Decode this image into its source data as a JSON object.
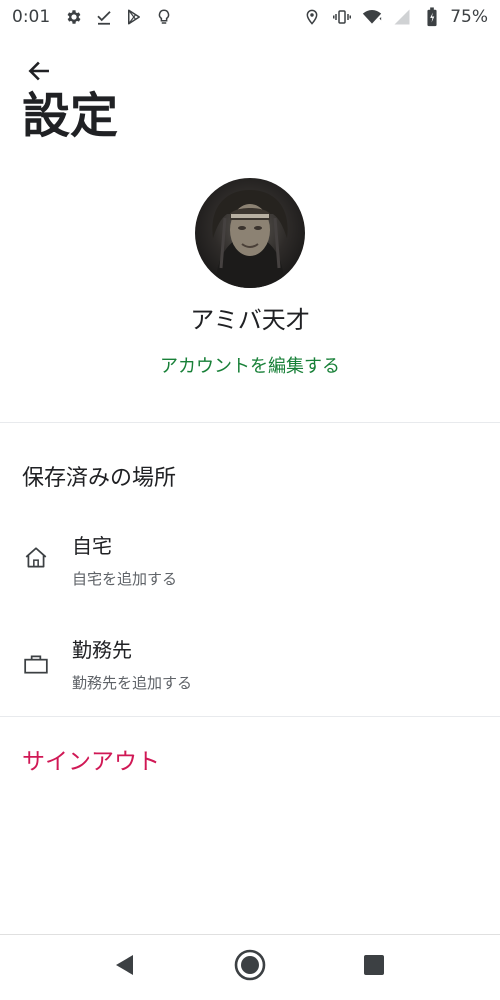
{
  "status_bar": {
    "time": "0:01",
    "battery": "75%",
    "left_icons": [
      "settings-icon",
      "check-icon",
      "play-store-icon",
      "lightbulb-icon"
    ],
    "right_icons": [
      "location-icon",
      "vibrate-icon",
      "wifi-icon",
      "cell-signal-icon",
      "battery-icon"
    ]
  },
  "header": {
    "back_icon": "arrow-left-icon",
    "title": "設定"
  },
  "profile": {
    "name": "アミバ天才",
    "edit_label": "アカウントを編集する"
  },
  "saved_places": {
    "title": "保存済みの場所",
    "items": [
      {
        "icon": "home-icon",
        "label": "自宅",
        "sublabel": "自宅を追加する"
      },
      {
        "icon": "briefcase-icon",
        "label": "勤務先",
        "sublabel": "勤務先を追加する"
      }
    ]
  },
  "sign_out": {
    "label": "サインアウト"
  },
  "colors": {
    "accent_green": "#188038",
    "sign_out_red": "#d01855",
    "text_primary": "#202124",
    "text_secondary": "#5f6368"
  },
  "nav_bar": {
    "buttons": [
      "back-triangle-icon",
      "home-circle-icon",
      "recents-square-icon"
    ]
  }
}
